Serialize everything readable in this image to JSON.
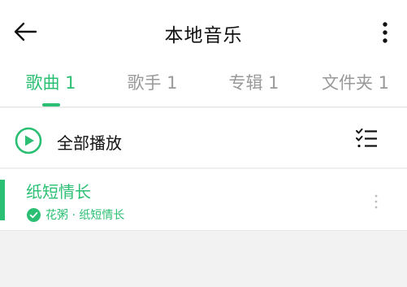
{
  "header": {
    "title": "本地音乐",
    "back_icon": "back-arrow-icon",
    "more_icon": "more-vertical-icon"
  },
  "tabs": [
    {
      "label": "歌曲 1",
      "active": true
    },
    {
      "label": "歌手 1",
      "active": false
    },
    {
      "label": "专辑 1",
      "active": false
    },
    {
      "label": "文件夹 1",
      "active": false
    }
  ],
  "playall": {
    "label": "全部播放",
    "play_icon": "play-circle-icon",
    "multiselect_icon": "multi-select-list-icon"
  },
  "songs": [
    {
      "title": "纸短情长",
      "meta": "花粥 · 纸短情长",
      "status_icon": "check-circle-icon",
      "more_icon": "more-vertical-icon"
    }
  ],
  "colors": {
    "accent": "#2bbf73",
    "text": "#111111",
    "muted": "#999999",
    "background": "#f2f2f2"
  }
}
